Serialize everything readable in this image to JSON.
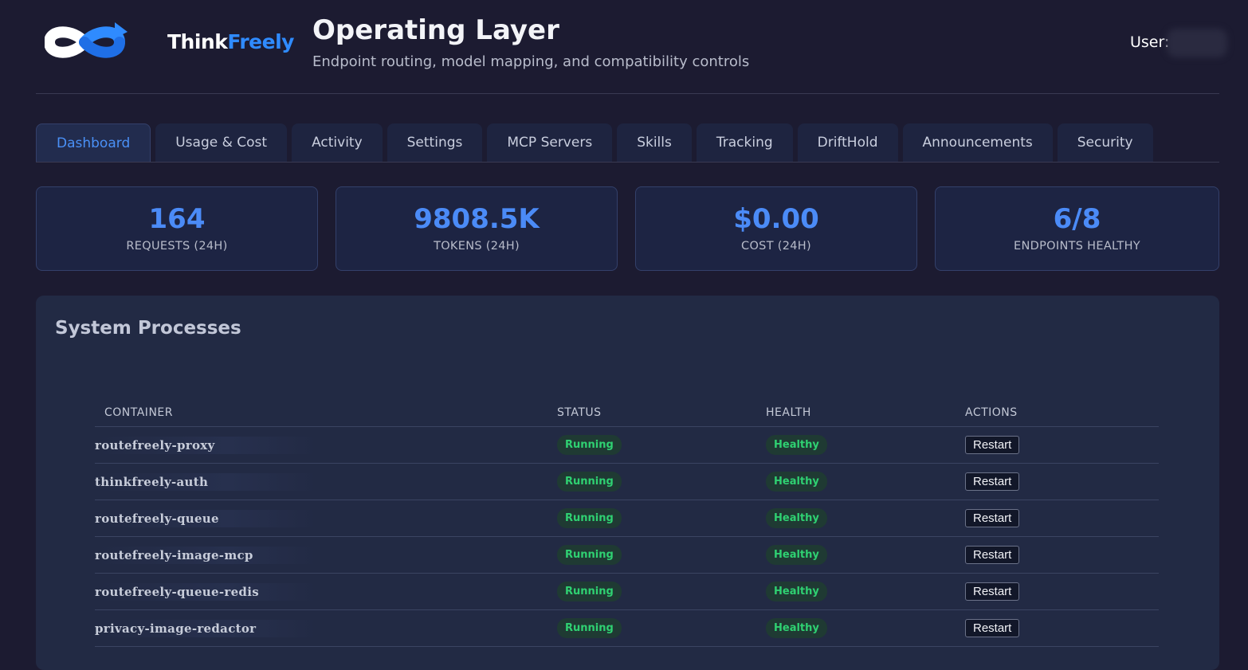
{
  "brand": {
    "name_part1": "Think",
    "name_part2": "Freely",
    "primary_color": "#2f8bff"
  },
  "header": {
    "title": "Operating Layer",
    "subtitle": "Endpoint routing, model mapping, and compatibility controls",
    "user_label": "User:"
  },
  "tabs": [
    {
      "label": "Dashboard",
      "active": true
    },
    {
      "label": "Usage & Cost"
    },
    {
      "label": "Activity"
    },
    {
      "label": "Settings"
    },
    {
      "label": "MCP Servers"
    },
    {
      "label": "Skills"
    },
    {
      "label": "Tracking"
    },
    {
      "label": "DriftHold"
    },
    {
      "label": "Announcements"
    },
    {
      "label": "Security"
    }
  ],
  "stats": [
    {
      "value": "164",
      "label": "REQUESTS (24H)"
    },
    {
      "value": "9808.5K",
      "label": "TOKENS (24H)"
    },
    {
      "value": "$0.00",
      "label": "COST (24H)"
    },
    {
      "value": "6/8",
      "label": "ENDPOINTS HEALTHY"
    }
  ],
  "processes": {
    "title": "System Processes",
    "columns": [
      "CONTAINER",
      "STATUS",
      "HEALTH",
      "ACTIONS"
    ],
    "rows": [
      {
        "name": "routefreely-proxy",
        "status": "Running",
        "health": "Healthy",
        "action": "Restart"
      },
      {
        "name": "thinkfreely-auth",
        "status": "Running",
        "health": "Healthy",
        "action": "Restart"
      },
      {
        "name": "routefreely-queue",
        "status": "Running",
        "health": "Healthy",
        "action": "Restart"
      },
      {
        "name": "routefreely-image-mcp",
        "status": "Running",
        "health": "Healthy",
        "action": "Restart"
      },
      {
        "name": "routefreely-queue-redis",
        "status": "Running",
        "health": "Healthy",
        "action": "Restart"
      },
      {
        "name": "privacy-image-redactor",
        "status": "Running",
        "health": "Healthy",
        "action": "Restart"
      }
    ]
  },
  "colors": {
    "accent": "#4b8bf7",
    "status_green": "#2fd172",
    "background": "#1c1b31"
  }
}
